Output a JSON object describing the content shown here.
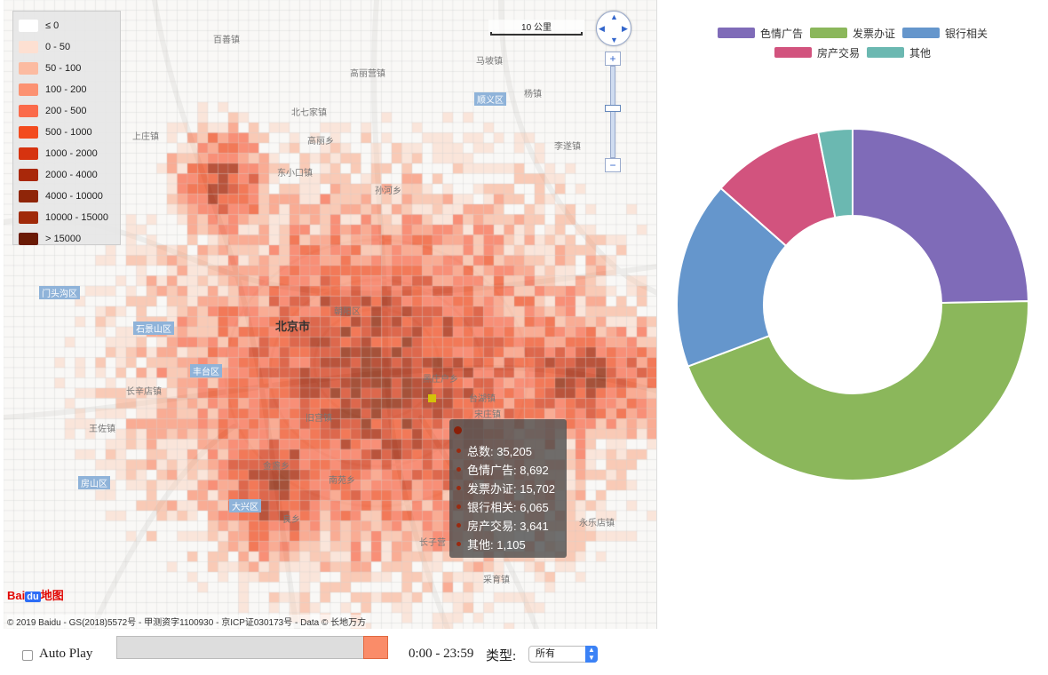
{
  "map": {
    "scale_label": "10 公里",
    "zoom_in_label": "+",
    "zoom_out_label": "−",
    "baidu_logo_a": "Bai",
    "baidu_logo_b": "du",
    "baidu_logo_c": "地图",
    "copyright": "© 2019 Baidu - GS(2018)5572号 - 甲测资字1100930 - 京ICP证030173号 - Data © 长地万方",
    "places": [
      {
        "text": "百善镇",
        "kind": "town"
      },
      {
        "text": "北七家镇",
        "kind": "town"
      },
      {
        "text": "高丽营镇",
        "kind": "town"
      },
      {
        "text": "马坡镇",
        "kind": "town"
      },
      {
        "text": "顺义区",
        "kind": "district"
      },
      {
        "text": "杨镇",
        "kind": "town"
      },
      {
        "text": "上庄镇",
        "kind": "town"
      },
      {
        "text": "东小口镇",
        "kind": "town"
      },
      {
        "text": "高丽乡",
        "kind": "town"
      },
      {
        "text": "孙河乡",
        "kind": "town"
      },
      {
        "text": "李遂镇",
        "kind": "town"
      },
      {
        "text": "门头沟区",
        "kind": "district"
      },
      {
        "text": "石景山区",
        "kind": "district"
      },
      {
        "text": "北京市",
        "kind": "city"
      },
      {
        "text": "朝阳区",
        "kind": "town"
      },
      {
        "text": "黑庄户乡",
        "kind": "town"
      },
      {
        "text": "台湖镇",
        "kind": "town"
      },
      {
        "text": "丰台区",
        "kind": "district"
      },
      {
        "text": "长辛店镇",
        "kind": "town"
      },
      {
        "text": "王佐镇",
        "kind": "town"
      },
      {
        "text": "金盏乡",
        "kind": "town"
      },
      {
        "text": "宋庄镇",
        "kind": "town"
      },
      {
        "text": "房山区",
        "kind": "district"
      },
      {
        "text": "大兴区",
        "kind": "district"
      },
      {
        "text": "旧宫镇",
        "kind": "town"
      },
      {
        "text": "长子营",
        "kind": "town"
      },
      {
        "text": "永乐店镇",
        "kind": "town"
      },
      {
        "text": "南苑乡",
        "kind": "town"
      },
      {
        "text": "良乡",
        "kind": "town"
      },
      {
        "text": "采育镇",
        "kind": "town"
      }
    ]
  },
  "legend": [
    {
      "label": "≤ 0",
      "color": "#ffffff"
    },
    {
      "label": "0 - 50",
      "color": "#fde0d2"
    },
    {
      "label": "50 - 100",
      "color": "#fcbba1"
    },
    {
      "label": "100 - 200",
      "color": "#fc9272"
    },
    {
      "label": "200 - 500",
      "color": "#fb6a4a"
    },
    {
      "label": "500 - 1000",
      "color": "#f34b1e"
    },
    {
      "label": "1000 - 2000",
      "color": "#d6330f"
    },
    {
      "label": "2000 - 4000",
      "color": "#a9280a"
    },
    {
      "label": "4000 - 10000",
      "color": "#8f2508"
    },
    {
      "label": "10000 - 15000",
      "color": "#a02a0a"
    },
    {
      "label": "> 15000",
      "color": "#6a1a05"
    }
  ],
  "tooltip": {
    "rows": [
      "总数: 35,205",
      "色情广告: 8,692",
      "发票办证: 15,702",
      "银行相关: 6,065",
      "房产交易: 3,641",
      "其他: 1,105"
    ]
  },
  "chart_data": {
    "type": "pie",
    "donut": true,
    "title": "",
    "legend_position": "top",
    "slices": [
      {
        "name": "色情广告",
        "value": 8692,
        "color": "#7f6bb8"
      },
      {
        "name": "发票办证",
        "value": 15702,
        "color": "#8bb75b"
      },
      {
        "name": "银行相关",
        "value": 6065,
        "color": "#6596cc"
      },
      {
        "name": "房产交易",
        "value": 3641,
        "color": "#d2537e"
      },
      {
        "name": "其他",
        "value": 1105,
        "color": "#6bb8b1"
      }
    ]
  },
  "controls": {
    "autoplay_label": "Auto Play",
    "time_range": "0:00 - 23:59",
    "type_label": "类型:",
    "type_selected": "所有",
    "slider_value_fraction": 1.0
  }
}
